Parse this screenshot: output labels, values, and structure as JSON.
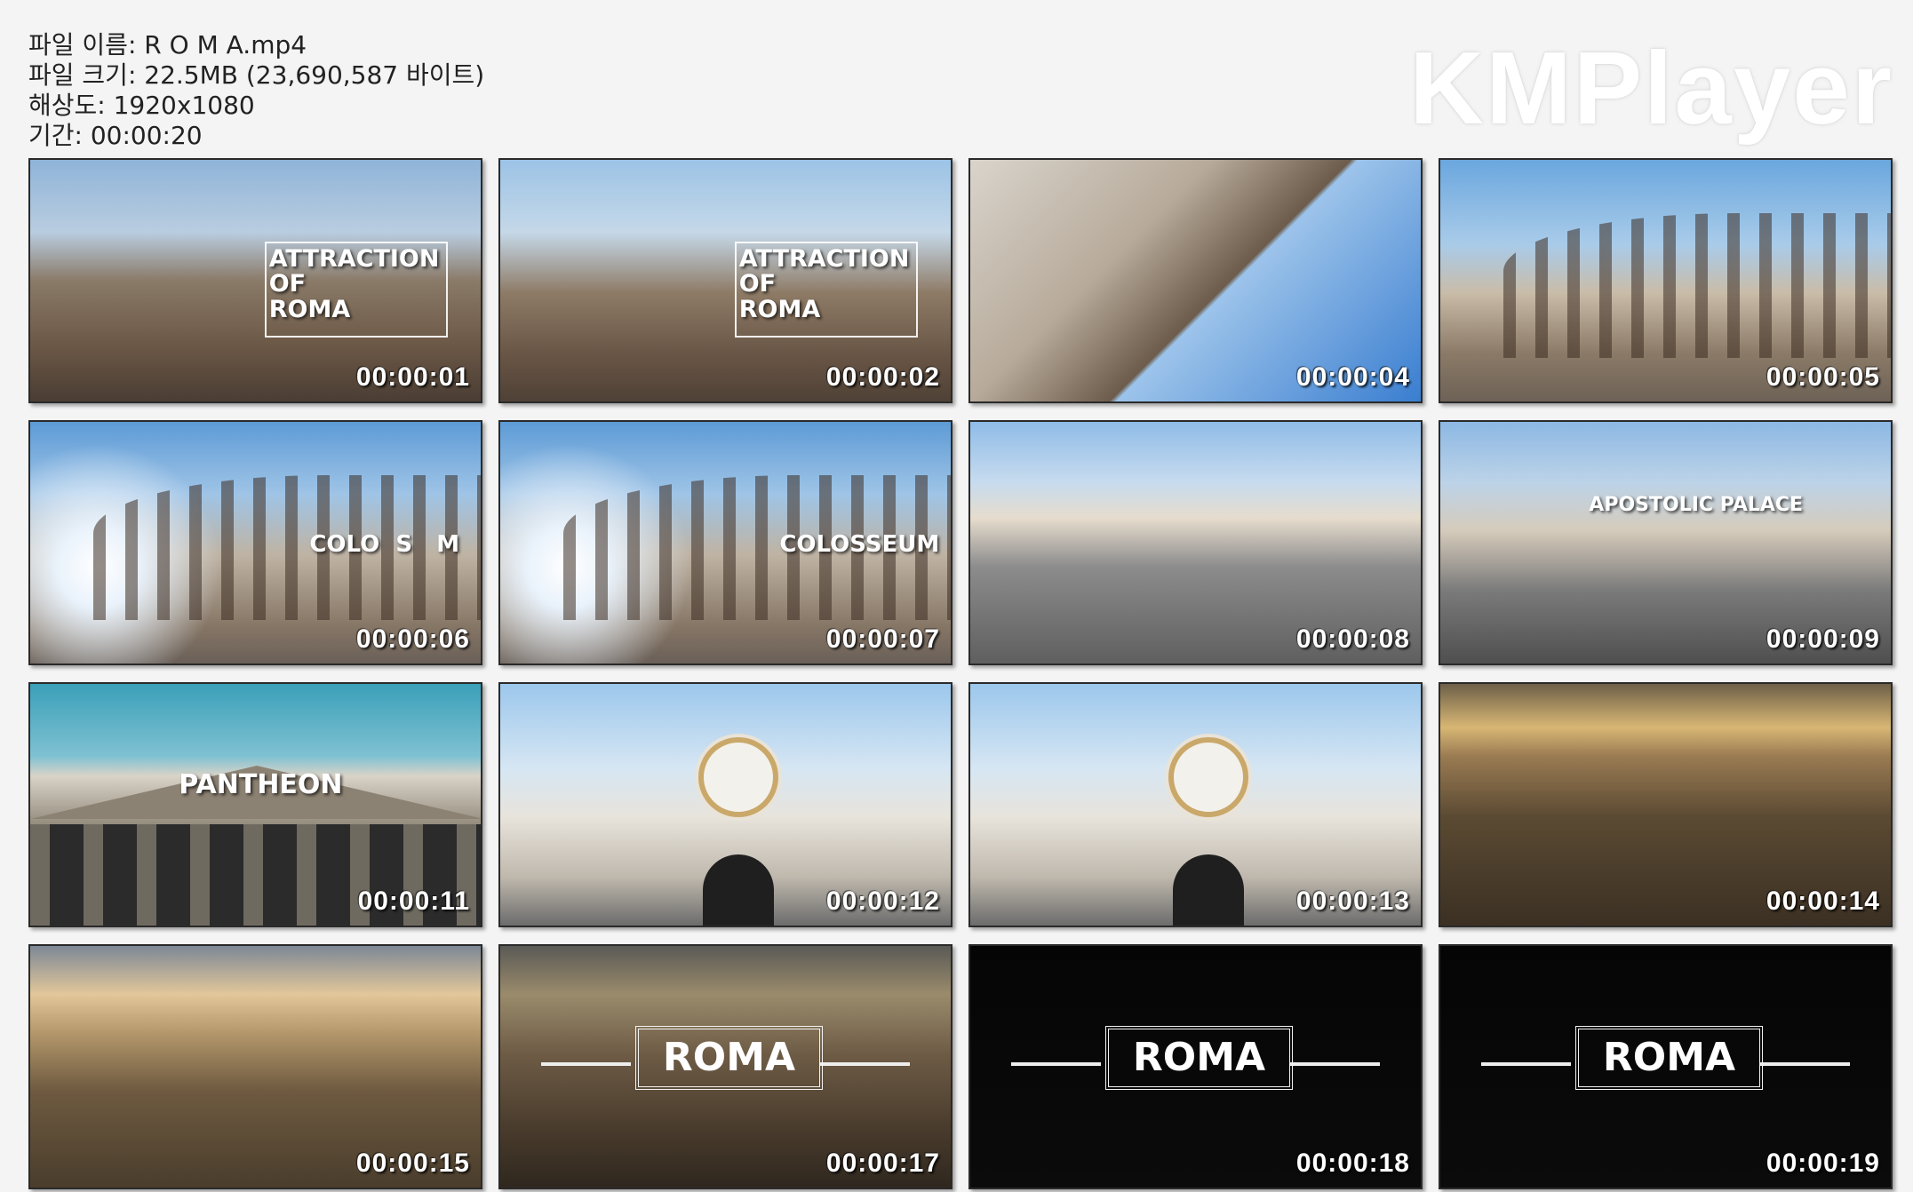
{
  "file_info": {
    "name": "파일 이름: R O M A.mp4",
    "size": "파일 크기: 22.5MB (23,690,587 바이트)",
    "resolution": "해상도: 1920x1080",
    "duration": "기간: 00:00:20"
  },
  "brand": "KMPlayer",
  "thumbnails": [
    {
      "time": "00:00:01",
      "scene": "aerial-city",
      "overlay": "ATTRACTION\nOF\nROMA"
    },
    {
      "time": "00:00:02",
      "scene": "aerial-dome",
      "overlay": "ATTRACTION\nOF\nROMA"
    },
    {
      "time": "00:00:04",
      "scene": "colosseum-arch",
      "overlay": ""
    },
    {
      "time": "00:00:05",
      "scene": "colosseum",
      "overlay": ""
    },
    {
      "time": "00:00:06",
      "scene": "colosseum-flare",
      "overlay": "COLO  S   M"
    },
    {
      "time": "00:00:07",
      "scene": "colosseum-flare",
      "overlay": "COLOSSEUM"
    },
    {
      "time": "00:00:08",
      "scene": "square",
      "overlay": ""
    },
    {
      "time": "00:00:09",
      "scene": "square-aerial",
      "overlay": "APOSTOLIC PALACE"
    },
    {
      "time": "00:00:11",
      "scene": "pantheon",
      "overlay": "PANTHEON"
    },
    {
      "time": "00:00:12",
      "scene": "clock",
      "overlay": ""
    },
    {
      "time": "00:00:13",
      "scene": "clock",
      "overlay": ""
    },
    {
      "time": "00:00:14",
      "scene": "sunset-ruins",
      "overlay": ""
    },
    {
      "time": "00:00:15",
      "scene": "sunset-city",
      "overlay": ""
    },
    {
      "time": "00:00:17",
      "scene": "sunset-roma",
      "overlay": "ROMA"
    },
    {
      "time": "00:00:18",
      "scene": "black-roma",
      "overlay": "ROMA"
    },
    {
      "time": "00:00:19",
      "scene": "black-roma",
      "overlay": "ROMA"
    }
  ],
  "colors": {
    "background": "#f4f4f4",
    "timecode": "#ffffff",
    "border": "#2a2a2a"
  }
}
